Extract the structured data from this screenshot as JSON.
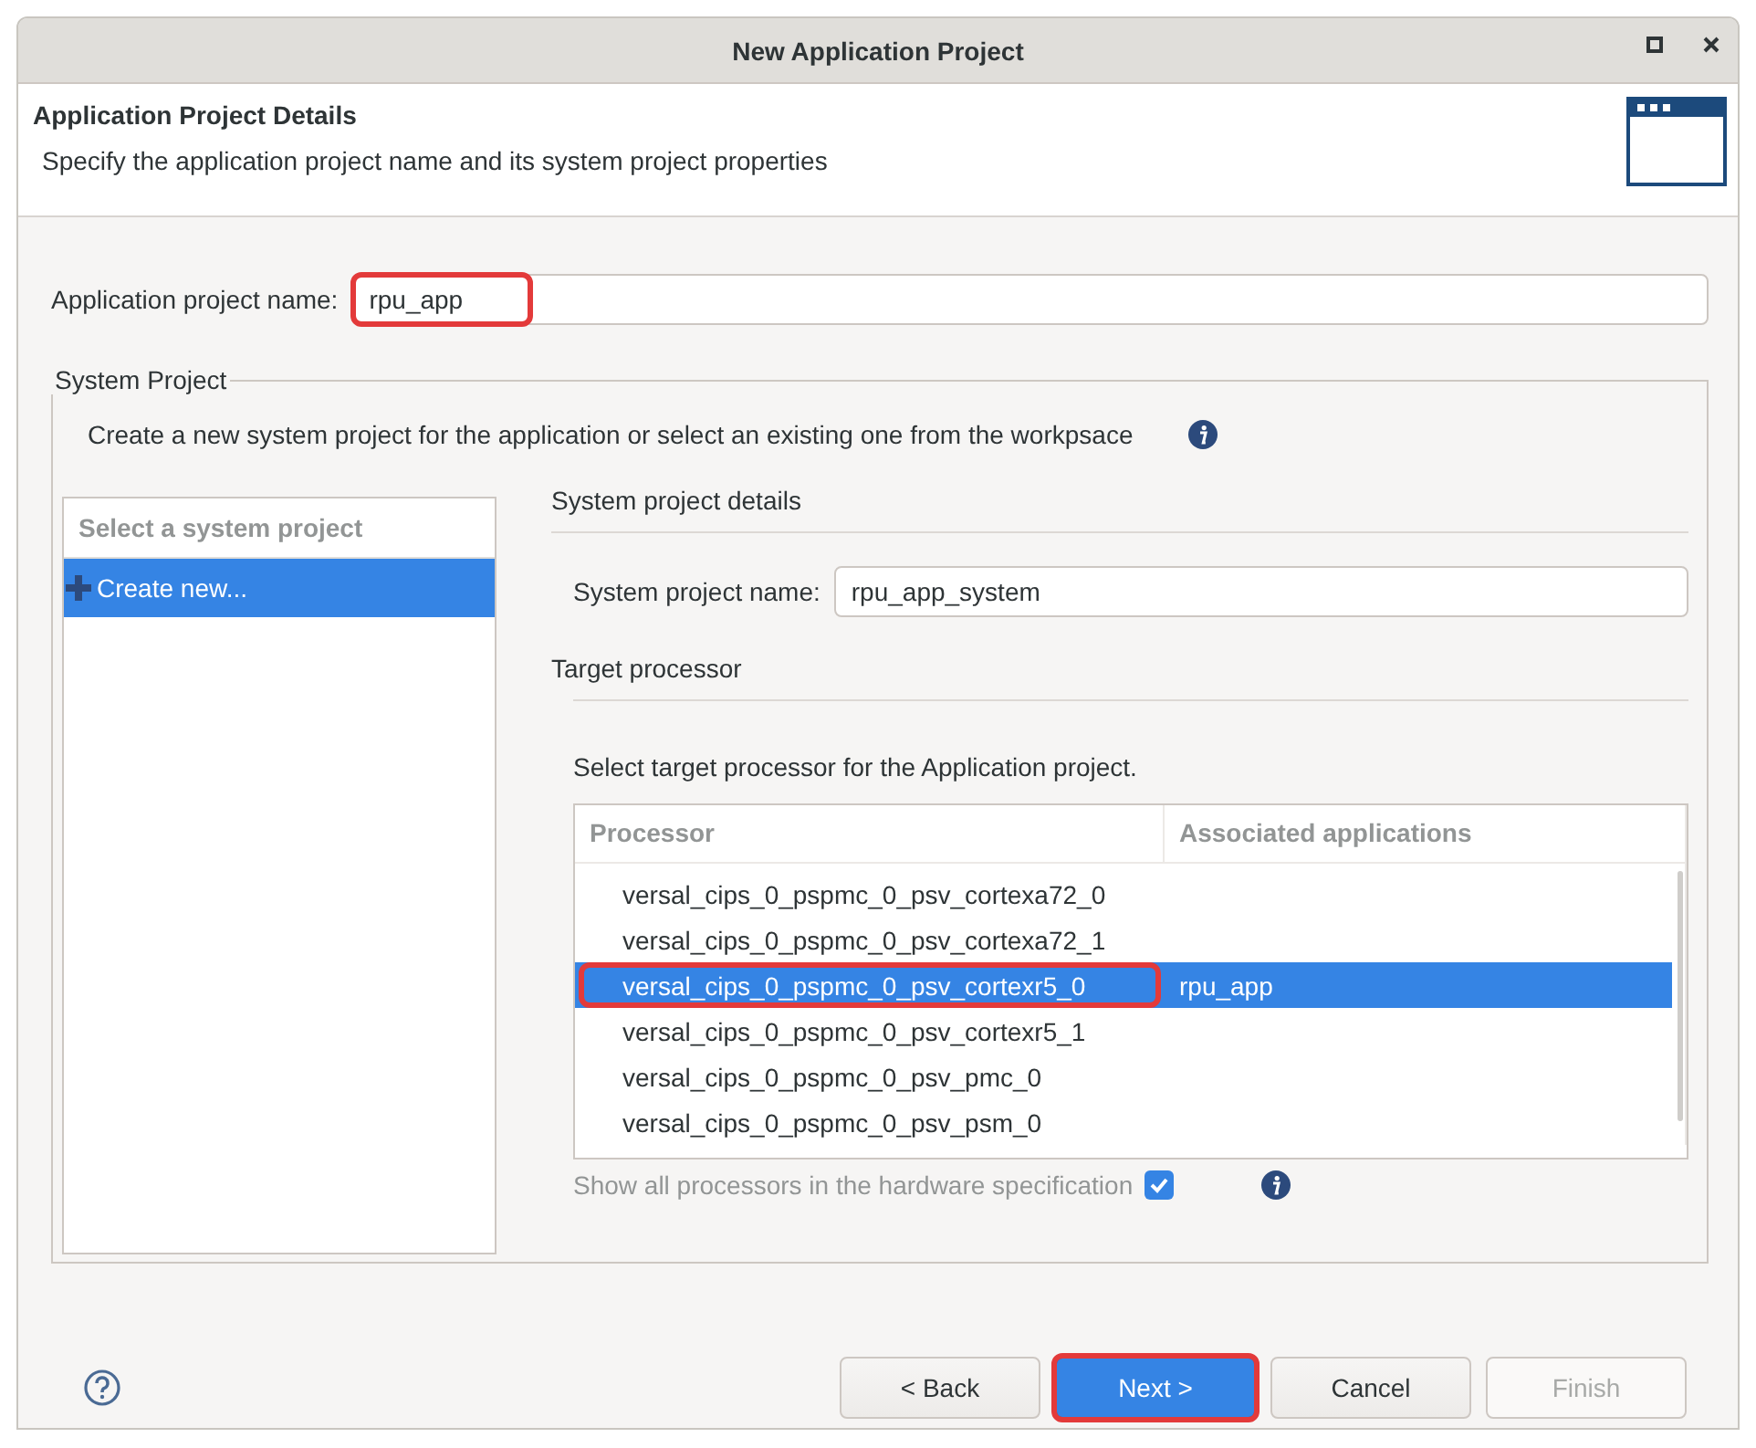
{
  "window": {
    "title": "New Application Project"
  },
  "header": {
    "title": "Application Project Details",
    "subtitle": "Specify the application project name and its system project properties"
  },
  "app_name": {
    "label": "Application project name:",
    "value": "rpu_app",
    "highlighted": true
  },
  "system_project": {
    "legend": "System Project",
    "description": "Create a new system project for the application or select an existing one from the workpsace",
    "list": {
      "header": "Select a system project",
      "items": [
        {
          "label": "Create new...",
          "selected": true
        }
      ]
    },
    "details": {
      "heading": "System project details",
      "name_label": "System project name:",
      "name_value": "rpu_app_system",
      "target_heading": "Target processor",
      "target_description": "Select target processor for the Application project.",
      "table": {
        "columns": [
          "Processor",
          "Associated applications"
        ],
        "rows": [
          {
            "processor": "versal_cips_0_pspmc_0_psv_cortexa72_0",
            "applications": "",
            "selected": false,
            "highlighted": false
          },
          {
            "processor": "versal_cips_0_pspmc_0_psv_cortexa72_1",
            "applications": "",
            "selected": false,
            "highlighted": false
          },
          {
            "processor": "versal_cips_0_pspmc_0_psv_cortexr5_0",
            "applications": "rpu_app",
            "selected": true,
            "highlighted": true
          },
          {
            "processor": "versal_cips_0_pspmc_0_psv_cortexr5_1",
            "applications": "",
            "selected": false,
            "highlighted": false
          },
          {
            "processor": "versal_cips_0_pspmc_0_psv_pmc_0",
            "applications": "",
            "selected": false,
            "highlighted": false
          },
          {
            "processor": "versal_cips_0_pspmc_0_psv_psm_0",
            "applications": "",
            "selected": false,
            "highlighted": false
          }
        ]
      },
      "show_all": {
        "label": "Show all processors in the hardware specification",
        "checked": true
      }
    }
  },
  "buttons": [
    {
      "label": "< Back",
      "kind": "normal",
      "highlighted": false
    },
    {
      "label": "Next >",
      "kind": "primary",
      "highlighted": true
    },
    {
      "label": "Cancel",
      "kind": "normal",
      "highlighted": false
    },
    {
      "label": "Finish",
      "kind": "disabled",
      "highlighted": false
    }
  ]
}
